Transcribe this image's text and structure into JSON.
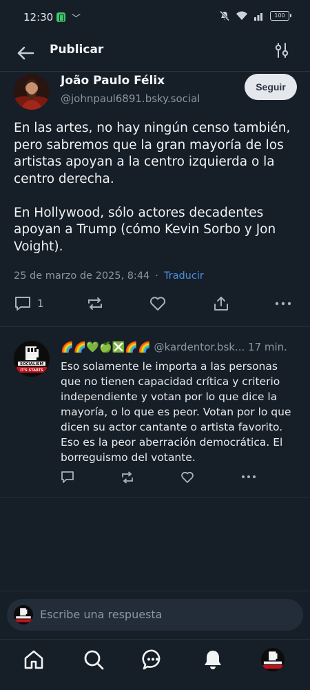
{
  "status_bar": {
    "time": "12:30",
    "battery": "100",
    "icons": [
      "app-notification-icon",
      "dash-icon",
      "mute-icon",
      "wifi-icon",
      "signal-icon",
      "battery-icon"
    ]
  },
  "header": {
    "title": "Publicar",
    "back_icon": "arrow-left-icon",
    "filter_icon": "sliders-icon"
  },
  "post": {
    "author_name": "João Paulo Félix",
    "author_handle": "@johnpaul6891.bsky.social",
    "follow_label": "Seguir",
    "text": "En las artes, no hay ningún censo también, pero sabremos que la gran mayoría de los artistas apoyan a la centro izquierda o la centro derecha.\n\nEn Hollywood, sólo actores decadentes apoyan a Trump (cómo Kevin Sorbo y Jon Voight).",
    "timestamp": "25 de marzo de 2025, 8:44",
    "separator": "·",
    "translate_label": "Traducir",
    "reply_count": "1"
  },
  "reply": {
    "display_name_emojis": "🌈🌈💚🍏❎🌈🌈",
    "handle": "@kardentor.bsk...",
    "time_ago": "17 min.",
    "avatar_text_top": "SOCIALISM",
    "avatar_text_bottom": "IT'S STARTS",
    "text": "Eso solamente le importa a las personas que no tienen capacidad crítica y criterio independiente y votan por lo que dice la mayoría, o lo que es peor. Votan por lo que dicen su actor cantante o artista favorito. Eso es la peor aberración democrática. El borreguismo del votante."
  },
  "composer": {
    "placeholder": "Escribe una respuesta"
  },
  "bottom_nav": {
    "items": [
      "home-icon",
      "search-icon",
      "chat-icon",
      "bell-icon",
      "profile-avatar"
    ]
  },
  "colors": {
    "background": "#161e27",
    "accent_link": "#4a90e2",
    "muted_text": "#8c96a3",
    "follow_button_bg": "#e4e7ec"
  }
}
